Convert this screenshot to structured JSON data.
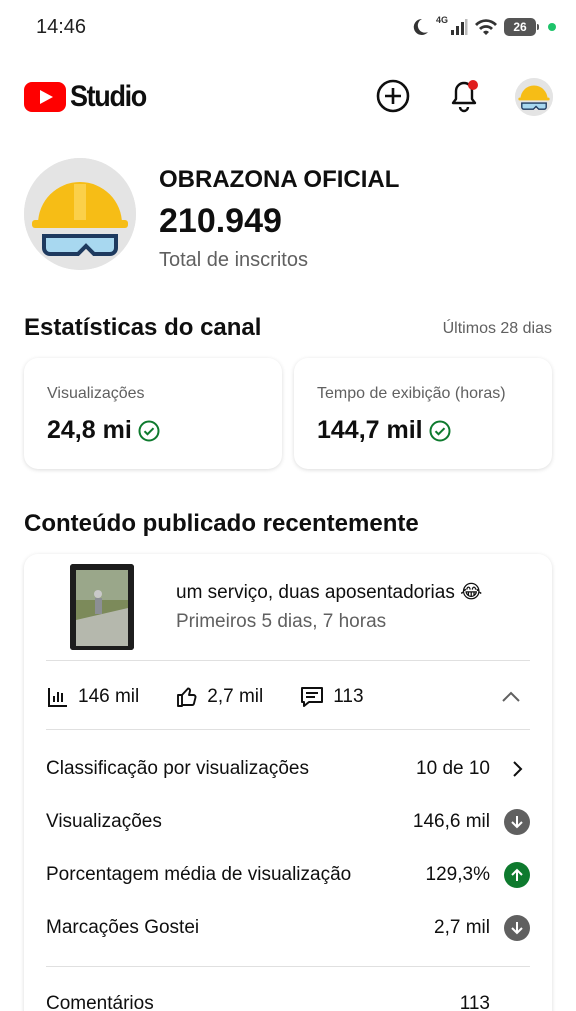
{
  "status_bar": {
    "time": "14:46",
    "network": "4G",
    "battery": "26"
  },
  "app_bar": {
    "logo_text": "Studio"
  },
  "channel": {
    "name": "OBRAZONA OFICIAL",
    "subscribers": "210.949",
    "subscribers_label": "Total de inscritos"
  },
  "stats": {
    "title": "Estatísticas do canal",
    "period": "Últimos 28 dias",
    "cards": [
      {
        "label": "Visualizações",
        "value": "24,8 mi"
      },
      {
        "label": "Tempo de exibição (horas)",
        "value": "144,7 mil"
      }
    ]
  },
  "recent": {
    "title": "Conteúdo publicado recentemente",
    "video": {
      "title": "um serviço, duas aposentadorias 😂",
      "subtitle": "Primeiros 5 dias, 7 horas",
      "views": "146 mil",
      "likes": "2,7 mil",
      "comments": "113"
    },
    "details": [
      {
        "label": "Classificação por visualizações",
        "value": "10 de 10",
        "icon": "chevron-right-icon"
      },
      {
        "label": "Visualizações",
        "value": "146,6 mil",
        "icon": "arrow-down-icon"
      },
      {
        "label": "Porcentagem média de visualização",
        "value": "129,3%",
        "icon": "arrow-up-icon"
      },
      {
        "label": "Marcações Gostei",
        "value": "2,7 mil",
        "icon": "arrow-down-icon"
      },
      {
        "label": "Comentários",
        "value": "113"
      }
    ]
  },
  "colors": {
    "brand_red": "#ff0000",
    "check_green": "#0e7a2e",
    "up_green": "#0e7a2e",
    "neutral_grey": "#606060"
  }
}
